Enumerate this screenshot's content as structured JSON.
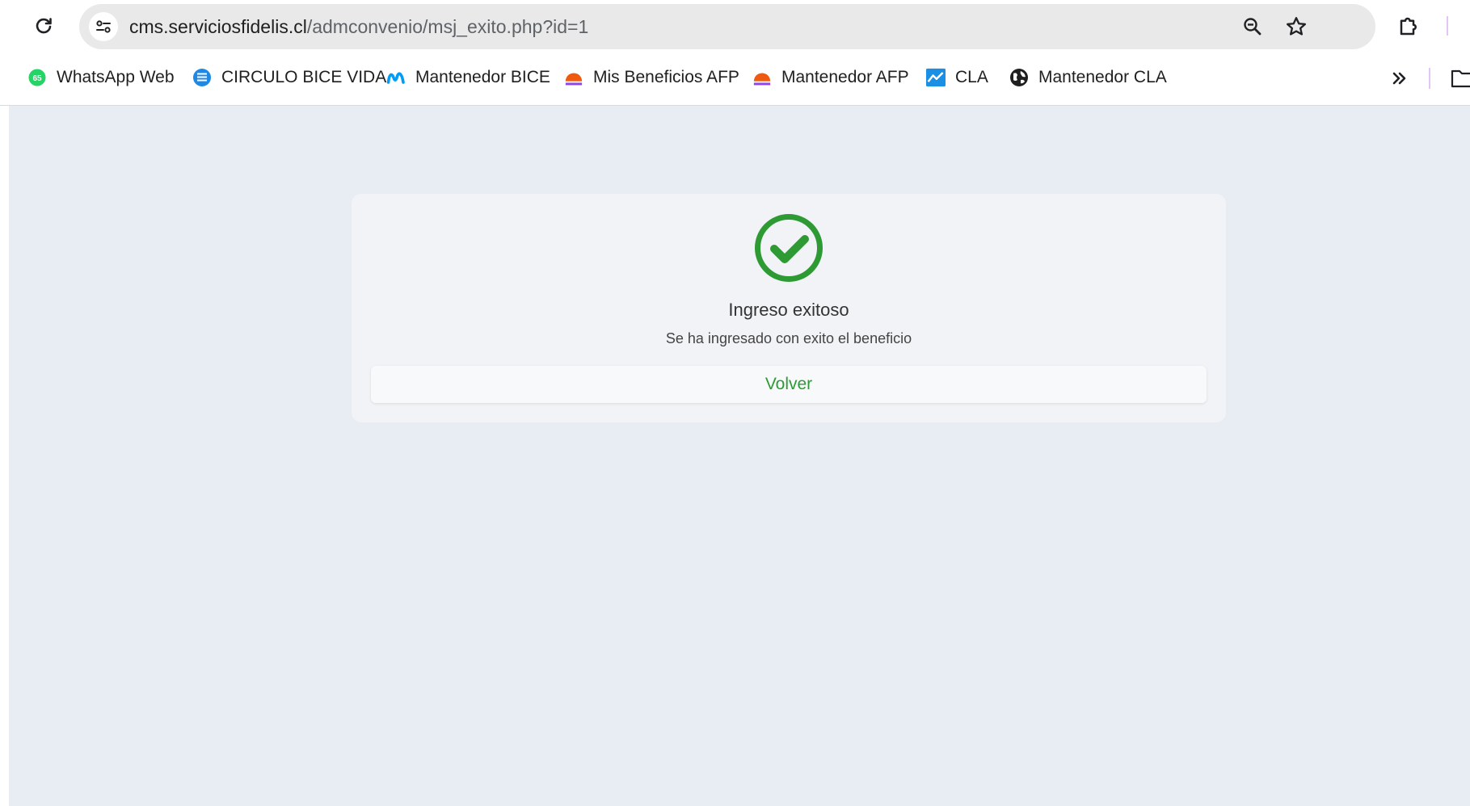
{
  "browser": {
    "url_host": "cms.serviciosfidelis.cl",
    "url_path": "/admconvenio/msj_exito.php?id=1",
    "icons": {
      "reload": "reload-icon",
      "site_info": "tune-icon",
      "zoom": "zoom-out-icon",
      "bookmark": "star-icon",
      "extensions": "puzzle-icon"
    }
  },
  "bookmarks": [
    {
      "label": "WhatsApp Web",
      "icon": "whatsapp-icon",
      "badge": "65"
    },
    {
      "label": "CIRCULO BICE VIDA",
      "icon": "bice-icon"
    },
    {
      "label": "Mantenedor BICE",
      "icon": "movistar-icon"
    },
    {
      "label": "Mis Beneficios AFP",
      "icon": "afp-icon"
    },
    {
      "label": "Mantenedor AFP",
      "icon": "afp-icon"
    },
    {
      "label": "CLA",
      "icon": "cla-icon"
    },
    {
      "label": "Mantenedor CLA",
      "icon": "globe-icon"
    }
  ],
  "main": {
    "title": "Ingreso exitoso",
    "message": "Se ha ingresado con exito el beneficio",
    "button_label": "Volver",
    "icon": "check-circle-icon"
  },
  "colors": {
    "success": "#2e9a33",
    "page_background": "#e8ecf3",
    "card_background": "#f1f3f6"
  }
}
